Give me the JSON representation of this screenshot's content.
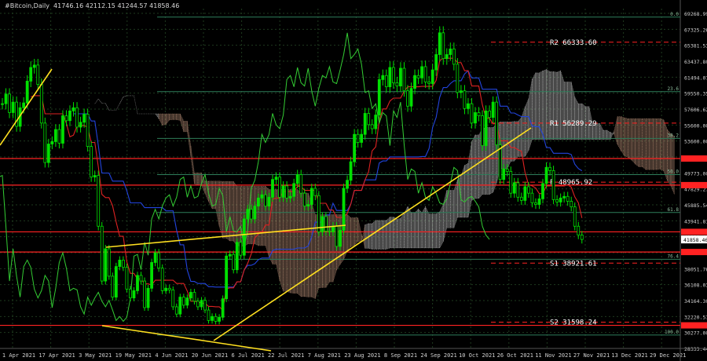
{
  "header": {
    "title": "#Bitcoin,Daily  41746.16 42112.15 41244.57 41858.46"
  },
  "colors": {
    "background": "#000000",
    "grid": "#1e3a1e",
    "price": "#00e000",
    "support_resistance": "#ff2222",
    "trendline": "#ffe020",
    "fib": "#2e7d5a",
    "cloud_bear": "#c89a80",
    "cloud_bull": "#d0d0d0",
    "tenkan": "#dd2222",
    "kijun": "#2244dd",
    "chikou": "#33cc33",
    "axis_text": "#d0d0d0"
  },
  "chart_data": {
    "type": "line",
    "title": "",
    "xlabel": "",
    "ylabel": "",
    "ylim": [
      28333.44,
      70500
    ],
    "grid": true,
    "y_ticks": [
      "69268.99",
      "67325.26",
      "65381.53",
      "63437.80",
      "61494.07",
      "59550.35",
      "57606.62",
      "55600.00",
      "53600.00",
      "51718.40",
      "49773.00",
      "47829.27",
      "45885.54",
      "43941.81",
      "41858.46",
      "39995.00",
      "38051.76",
      "36108.03",
      "34164.30",
      "32220.57",
      "30277.00",
      "28333.44"
    ],
    "x_ticks": [
      "1 Apr 2021",
      "17 Apr 2021",
      "3 May 2021",
      "19 May 2021",
      "4 Jun 2021",
      "20 Jun 2021",
      "6 Jul 2021",
      "22 Jul 2021",
      "7 Aug 2021",
      "23 Aug 2021",
      "8 Sep 2021",
      "24 Sep 2021",
      "10 Oct 2021",
      "26 Oct 2021",
      "11 Nov 2021",
      "27 Nov 2021",
      "13 Dec 2021",
      "29 Dec 2021"
    ],
    "levels": [
      {
        "label": "R2",
        "value": "66333.60",
        "y": 66333.6
      },
      {
        "label": "R1",
        "value": "56289.29",
        "y": 56289.29
      },
      {
        "label": "P",
        "value": "48965.92",
        "y": 48965.92
      },
      {
        "label": "S1",
        "value": "38921.61",
        "y": 38921.61
      },
      {
        "label": "S2",
        "value": "31598.24",
        "y": 31598.24
      }
    ],
    "red_lines": [
      51900,
      48600,
      42800,
      40300,
      31200
    ],
    "fib_levels": [
      {
        "label": "0.0",
        "y": 69450
      },
      {
        "label": "23.6",
        "y": 60200
      },
      {
        "label": "38.2",
        "y": 54400
      },
      {
        "label": "50.0",
        "y": 49900
      },
      {
        "label": "61.8",
        "y": 45200
      },
      {
        "label": "76.4",
        "y": 39400
      },
      {
        "label": "100.0",
        "y": 30000
      }
    ],
    "series": [
      {
        "values": [
          [
            0,
            58700
          ],
          [
            1,
            59900
          ],
          [
            2,
            57600
          ],
          [
            3,
            58900
          ],
          [
            4,
            55900
          ],
          [
            5,
            58200
          ],
          [
            6,
            58800
          ],
          [
            7,
            61500
          ],
          [
            8,
            63200
          ],
          [
            9,
            63500
          ],
          [
            10,
            61100
          ],
          [
            11,
            56300
          ],
          [
            12,
            51400
          ],
          [
            13,
            53700
          ],
          [
            14,
            54000
          ],
          [
            15,
            55500
          ],
          [
            16,
            53800
          ],
          [
            17,
            57200
          ],
          [
            18,
            56600
          ],
          [
            19,
            57800
          ],
          [
            20,
            58200
          ],
          [
            21,
            55800
          ],
          [
            22,
            56400
          ],
          [
            23,
            57400
          ],
          [
            24,
            53400
          ],
          [
            25,
            49600
          ],
          [
            26,
            49800
          ],
          [
            27,
            43500
          ],
          [
            28,
            36700
          ],
          [
            29,
            40700
          ],
          [
            30,
            37300
          ],
          [
            31,
            34700
          ],
          [
            32,
            38500
          ],
          [
            33,
            39300
          ],
          [
            34,
            38400
          ],
          [
            35,
            35700
          ],
          [
            36,
            34600
          ],
          [
            37,
            35500
          ],
          [
            38,
            37400
          ],
          [
            39,
            36700
          ],
          [
            40,
            33400
          ],
          [
            41,
            35800
          ],
          [
            42,
            39000
          ],
          [
            43,
            40200
          ],
          [
            44,
            38300
          ],
          [
            45,
            35500
          ],
          [
            46,
            35800
          ],
          [
            47,
            35600
          ],
          [
            48,
            33500
          ],
          [
            49,
            32600
          ],
          [
            50,
            34700
          ],
          [
            51,
            33700
          ],
          [
            52,
            34600
          ],
          [
            53,
            35300
          ],
          [
            54,
            34200
          ],
          [
            55,
            33500
          ],
          [
            56,
            34300
          ],
          [
            57,
            33100
          ],
          [
            58,
            31800
          ],
          [
            59,
            32300
          ],
          [
            60,
            31700
          ],
          [
            61,
            32200
          ],
          [
            62,
            34500
          ],
          [
            63,
            39800
          ],
          [
            64,
            40000
          ],
          [
            65,
            38100
          ],
          [
            66,
            41500
          ],
          [
            67,
            39900
          ],
          [
            68,
            44400
          ],
          [
            69,
            45600
          ],
          [
            70,
            44400
          ],
          [
            71,
            46000
          ],
          [
            72,
            47000
          ],
          [
            73,
            47400
          ],
          [
            74,
            46000
          ],
          [
            75,
            47100
          ],
          [
            76,
            49300
          ],
          [
            77,
            49600
          ],
          [
            78,
            47100
          ],
          [
            79,
            48500
          ],
          [
            80,
            47000
          ],
          [
            81,
            47200
          ],
          [
            82,
            48800
          ],
          [
            83,
            49900
          ],
          [
            84,
            47600
          ],
          [
            85,
            46000
          ],
          [
            86,
            46200
          ],
          [
            87,
            48200
          ],
          [
            88,
            47300
          ],
          [
            89,
            42800
          ],
          [
            90,
            44700
          ],
          [
            91,
            42900
          ],
          [
            92,
            42800
          ],
          [
            93,
            43500
          ],
          [
            94,
            41000
          ],
          [
            95,
            43000
          ],
          [
            96,
            48200
          ],
          [
            97,
            49200
          ],
          [
            98,
            51500
          ],
          [
            99,
            54900
          ],
          [
            100,
            53900
          ],
          [
            101,
            54900
          ],
          [
            102,
            57500
          ],
          [
            103,
            56100
          ],
          [
            104,
            55600
          ],
          [
            105,
            57300
          ],
          [
            106,
            61700
          ],
          [
            107,
            62200
          ],
          [
            108,
            60800
          ],
          [
            109,
            63200
          ],
          [
            110,
            61300
          ],
          [
            111,
            60900
          ],
          [
            112,
            63100
          ],
          [
            113,
            60300
          ],
          [
            114,
            58400
          ],
          [
            115,
            60600
          ],
          [
            116,
            62200
          ],
          [
            117,
            61900
          ],
          [
            118,
            63300
          ],
          [
            119,
            61400
          ],
          [
            120,
            61200
          ],
          [
            121,
            62900
          ],
          [
            122,
            64800
          ],
          [
            123,
            67500
          ],
          [
            124,
            64300
          ],
          [
            125,
            64800
          ],
          [
            126,
            65500
          ],
          [
            127,
            63600
          ],
          [
            128,
            60100
          ],
          [
            129,
            60300
          ],
          [
            130,
            58100
          ],
          [
            131,
            58700
          ],
          [
            132,
            56300
          ],
          [
            133,
            57600
          ],
          [
            134,
            57200
          ],
          [
            135,
            53500
          ],
          [
            136,
            57800
          ],
          [
            137,
            57000
          ],
          [
            138,
            58900
          ],
          [
            139,
            53600
          ],
          [
            140,
            49300
          ],
          [
            141,
            50600
          ],
          [
            142,
            50300
          ],
          [
            143,
            47600
          ],
          [
            144,
            48900
          ],
          [
            145,
            47100
          ],
          [
            146,
            46700
          ],
          [
            147,
            48400
          ],
          [
            148,
            47600
          ],
          [
            149,
            46400
          ],
          [
            150,
            46200
          ],
          [
            151,
            46900
          ],
          [
            152,
            48800
          ],
          [
            153,
            50800
          ],
          [
            154,
            50400
          ],
          [
            155,
            46800
          ],
          [
            156,
            46500
          ],
          [
            157,
            47000
          ],
          [
            158,
            47200
          ],
          [
            159,
            46600
          ],
          [
            160,
            45900
          ],
          [
            161,
            43500
          ],
          [
            162,
            42400
          ],
          [
            163,
            41858
          ]
        ]
      }
    ]
  }
}
